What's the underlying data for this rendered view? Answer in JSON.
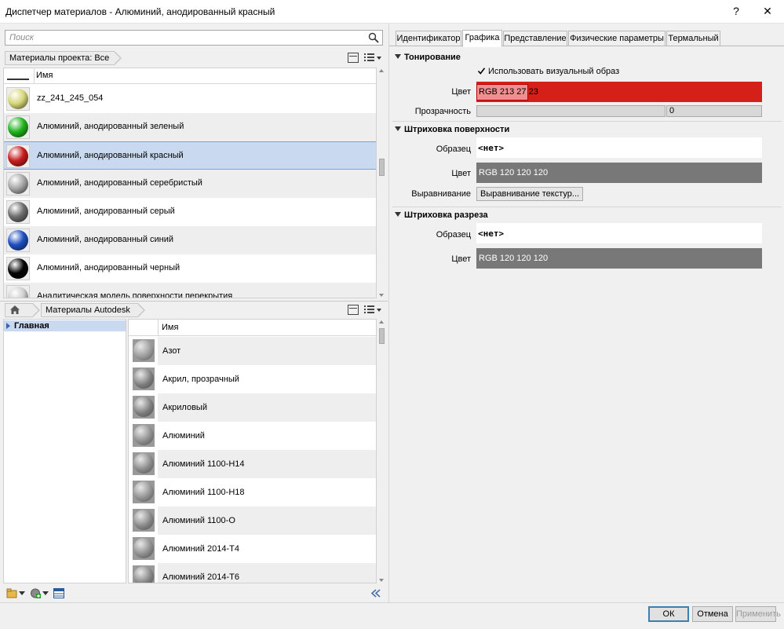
{
  "window": {
    "title": "Диспетчер материалов - Алюминий, анодированный красный",
    "help": "?",
    "close": "✕"
  },
  "search": {
    "placeholder": "Поиск"
  },
  "project_materials": {
    "breadcrumb": "Материалы проекта: Все",
    "column_name": "Имя",
    "rows": [
      {
        "label": "zz_241_245_054",
        "color": "#d7d77a"
      },
      {
        "label": "Алюминий, анодированный зеленый",
        "color": "#22b41e"
      },
      {
        "label": "Алюминий, анодированный красный",
        "color": "#c81e1e",
        "selected": true
      },
      {
        "label": "Алюминий, анодированный серебристый",
        "color": "#a8a8a8"
      },
      {
        "label": "Алюминий, анодированный серый",
        "color": "#6e6e6e"
      },
      {
        "label": "Алюминий, анодированный синий",
        "color": "#1e50c0"
      },
      {
        "label": "Алюминий, анодированный черный",
        "color": "#050505"
      },
      {
        "label": "Аналитическая модель поверхности перекрытия",
        "color": "#cfcfcf"
      }
    ]
  },
  "library": {
    "breadcrumb": "Материалы Autodesk",
    "tree_item": "Главная",
    "column_name": "Имя",
    "rows": [
      {
        "label": "Азот",
        "color": "#9a9a9a"
      },
      {
        "label": "Акрил, прозрачный",
        "color": "#7c7c7c"
      },
      {
        "label": "Акриловый",
        "color": "#7c7c7c"
      },
      {
        "label": "Алюминий",
        "color": "#8c8c8c"
      },
      {
        "label": "Алюминий 1100-H14",
        "color": "#888888"
      },
      {
        "label": "Алюминий 1100-H18",
        "color": "#909090"
      },
      {
        "label": "Алюминий 1100-O",
        "color": "#858585"
      },
      {
        "label": "Алюминий 2014-T4",
        "color": "#8a8a8a"
      },
      {
        "label": "Алюминий 2014-T6",
        "color": "#848484"
      }
    ]
  },
  "tabs": [
    "Идентификатор",
    "Графика",
    "Представление",
    "Физические параметры",
    "Термальный"
  ],
  "graphics": {
    "shading": {
      "title": "Тонирование",
      "use_render_label": "Использовать визуальный образ",
      "use_render_checked": true,
      "color_label": "Цвет",
      "color_value": "RGB 213 27 23",
      "color_hex": "#d51b17",
      "transparency_label": "Прозрачность",
      "transparency_value": "0"
    },
    "surface_pattern": {
      "title": "Штриховка поверхности",
      "pattern_label": "Образец",
      "pattern_value": "<нет>",
      "color_label": "Цвет",
      "color_value": "RGB 120 120 120",
      "align_label": "Выравнивание",
      "align_button": "Выравнивание текстур..."
    },
    "cut_pattern": {
      "title": "Штриховка разреза",
      "pattern_label": "Образец",
      "pattern_value": "<нет>",
      "color_label": "Цвет",
      "color_value": "RGB 120 120 120"
    }
  },
  "footer": {
    "ok": "ОК",
    "cancel": "Отмена",
    "apply": "Применить"
  }
}
